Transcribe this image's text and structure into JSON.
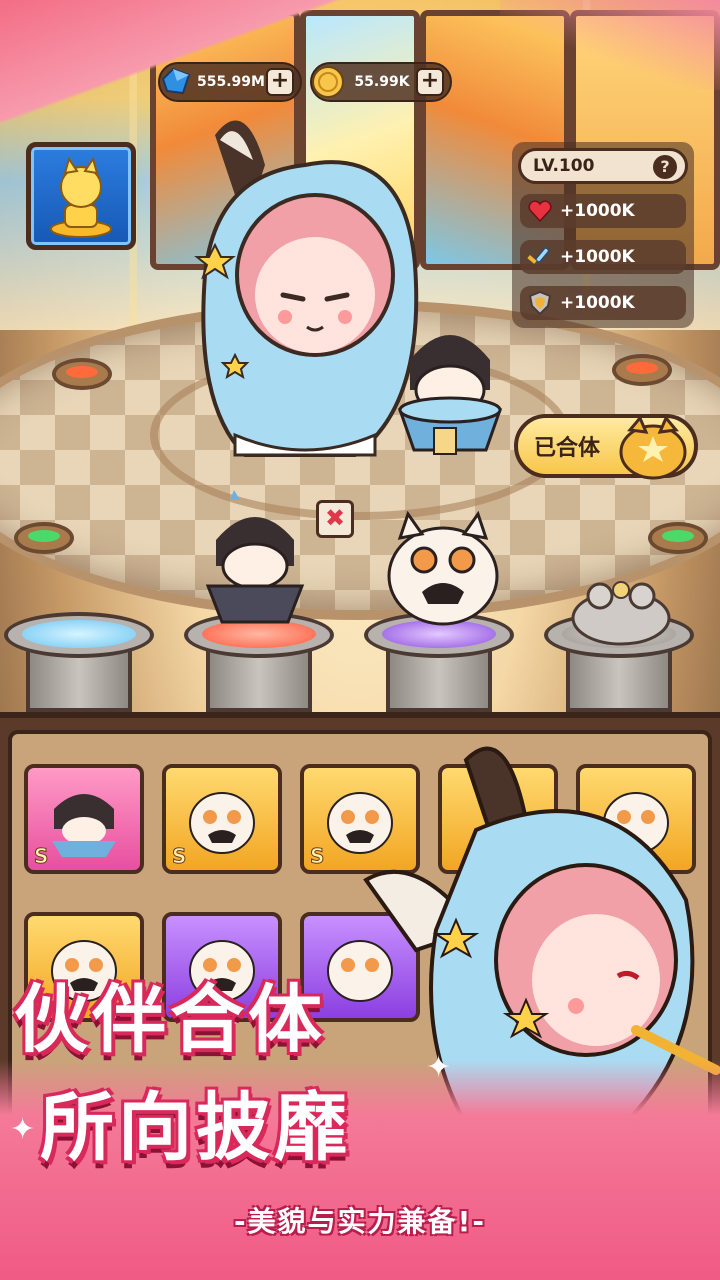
{
  "resources": {
    "gems": "555.99M",
    "coins": "55.99K",
    "plus": "+"
  },
  "stats": {
    "level": "LV.100",
    "help": "?",
    "hp": "+1000K",
    "attack": "+1000K",
    "defense": "+1000K"
  },
  "merge": {
    "status_label": "已合体",
    "remove": "✖"
  },
  "inventory": {
    "rank_label": "S"
  },
  "promo": {
    "headline_1": "伙伴合体",
    "headline_2": "所向披靡",
    "tagline": "-美貌与实力兼备!-"
  },
  "colors": {
    "accent_pink": "#f05a85",
    "panel_brown": "#4a2d1f",
    "gold": "#f8c64a"
  }
}
